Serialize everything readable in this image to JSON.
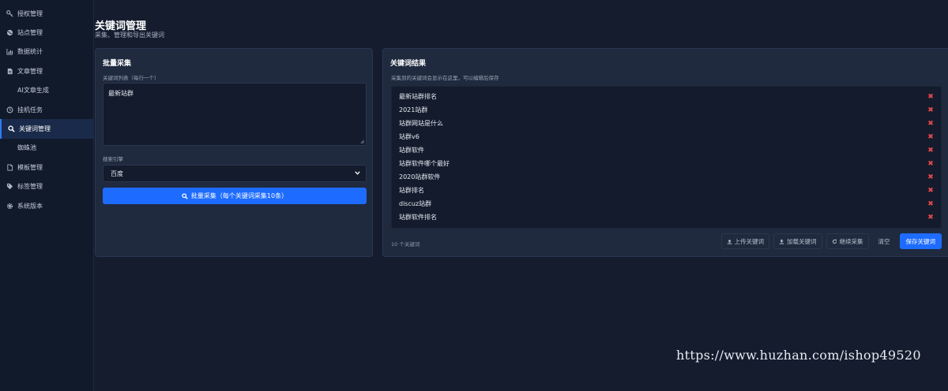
{
  "sidebar": {
    "items": [
      {
        "label": "授权管理",
        "icon": "key-icon"
      },
      {
        "label": "站点管理",
        "icon": "globe-icon"
      },
      {
        "label": "数据统计",
        "icon": "bar-chart-icon"
      },
      {
        "label": "文章管理",
        "icon": "document-icon"
      },
      {
        "label": "AI文章生成",
        "icon": ""
      },
      {
        "label": "挂机任务",
        "icon": "clock-icon"
      },
      {
        "label": "关键词管理",
        "icon": "search-icon",
        "active": true
      },
      {
        "label": "蜘蛛池",
        "icon": ""
      },
      {
        "label": "模板管理",
        "icon": "file-icon"
      },
      {
        "label": "标签管理",
        "icon": "tags-icon"
      },
      {
        "label": "系统版本",
        "icon": "gear-icon"
      }
    ]
  },
  "header": {
    "title": "关键词管理",
    "subtitle": "采集、管理和导出关键词"
  },
  "batch": {
    "title": "批量采集",
    "list_label": "关键词列表（每行一个）",
    "textarea_value": "最新站群",
    "engine_label": "搜索引擎",
    "engine_selected": "百度",
    "submit_label": "批量采集（每个关键词采集10条）"
  },
  "results": {
    "title": "关键词结果",
    "hint": "采集到的关键词会显示在这里，可以编辑后保存",
    "keywords": [
      "最新站群排名",
      "2021站群",
      "站群网站是什么",
      "站群v6",
      "站群软件",
      "站群软件哪个最好",
      "2020站群软件",
      "站群排名",
      "discuz站群",
      "站群软件排名"
    ],
    "count_label": "10 个关键词",
    "buttons": {
      "upload": "上传关键词",
      "load": "加载关键词",
      "continue": "继续采集",
      "clear": "清空",
      "save": "保存关键词"
    }
  },
  "watermark": "https://www.huzhan.com/ishop49520",
  "colors": {
    "accent": "#1e6cff",
    "delete": "#e5484d",
    "background": "#141c2e",
    "panel": "#1f2a3f"
  }
}
